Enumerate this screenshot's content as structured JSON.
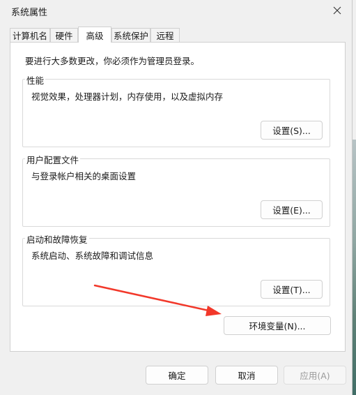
{
  "window": {
    "title": "系统属性"
  },
  "tabs": [
    {
      "label": "计算机名"
    },
    {
      "label": "硬件"
    },
    {
      "label": "高级"
    },
    {
      "label": "系统保护"
    },
    {
      "label": "远程"
    }
  ],
  "notice": "要进行大多数更改，你必须作为管理员登录。",
  "groups": {
    "performance": {
      "title": "性能",
      "desc": "视觉效果，处理器计划，内存使用，以及虚拟内存",
      "button": "设置(S)..."
    },
    "user_profiles": {
      "title": "用户配置文件",
      "desc": "与登录帐户相关的桌面设置",
      "button": "设置(E)..."
    },
    "startup_recovery": {
      "title": "启动和故障恢复",
      "desc": "系统启动、系统故障和调试信息",
      "button": "设置(T)..."
    }
  },
  "env_button": "环境变量(N)...",
  "footer": {
    "ok": "确定",
    "cancel": "取消",
    "apply": "应用(A)"
  },
  "annotation": {
    "arrow_color": "#f2382a"
  }
}
